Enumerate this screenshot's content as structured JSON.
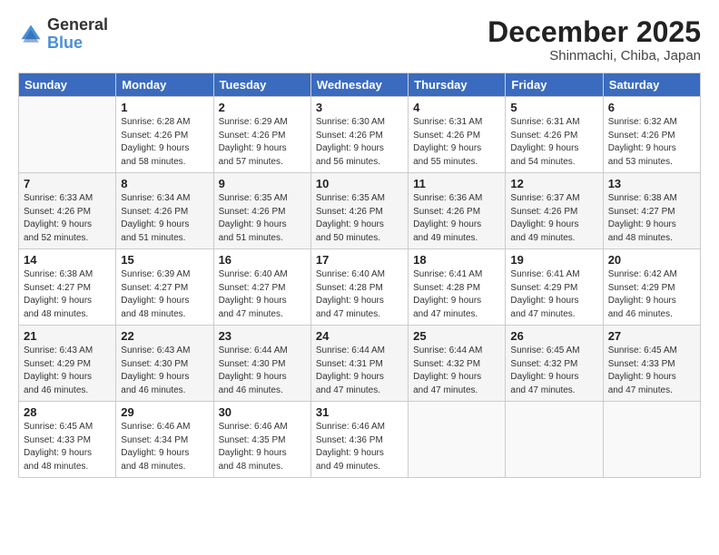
{
  "header": {
    "logo_general": "General",
    "logo_blue": "Blue",
    "month_title": "December 2025",
    "location": "Shinmachi, Chiba, Japan"
  },
  "days_of_week": [
    "Sunday",
    "Monday",
    "Tuesday",
    "Wednesday",
    "Thursday",
    "Friday",
    "Saturday"
  ],
  "weeks": [
    [
      {
        "day": "",
        "info": ""
      },
      {
        "day": "1",
        "info": "Sunrise: 6:28 AM\nSunset: 4:26 PM\nDaylight: 9 hours\nand 58 minutes."
      },
      {
        "day": "2",
        "info": "Sunrise: 6:29 AM\nSunset: 4:26 PM\nDaylight: 9 hours\nand 57 minutes."
      },
      {
        "day": "3",
        "info": "Sunrise: 6:30 AM\nSunset: 4:26 PM\nDaylight: 9 hours\nand 56 minutes."
      },
      {
        "day": "4",
        "info": "Sunrise: 6:31 AM\nSunset: 4:26 PM\nDaylight: 9 hours\nand 55 minutes."
      },
      {
        "day": "5",
        "info": "Sunrise: 6:31 AM\nSunset: 4:26 PM\nDaylight: 9 hours\nand 54 minutes."
      },
      {
        "day": "6",
        "info": "Sunrise: 6:32 AM\nSunset: 4:26 PM\nDaylight: 9 hours\nand 53 minutes."
      }
    ],
    [
      {
        "day": "7",
        "info": "Sunrise: 6:33 AM\nSunset: 4:26 PM\nDaylight: 9 hours\nand 52 minutes."
      },
      {
        "day": "8",
        "info": "Sunrise: 6:34 AM\nSunset: 4:26 PM\nDaylight: 9 hours\nand 51 minutes."
      },
      {
        "day": "9",
        "info": "Sunrise: 6:35 AM\nSunset: 4:26 PM\nDaylight: 9 hours\nand 51 minutes."
      },
      {
        "day": "10",
        "info": "Sunrise: 6:35 AM\nSunset: 4:26 PM\nDaylight: 9 hours\nand 50 minutes."
      },
      {
        "day": "11",
        "info": "Sunrise: 6:36 AM\nSunset: 4:26 PM\nDaylight: 9 hours\nand 49 minutes."
      },
      {
        "day": "12",
        "info": "Sunrise: 6:37 AM\nSunset: 4:26 PM\nDaylight: 9 hours\nand 49 minutes."
      },
      {
        "day": "13",
        "info": "Sunrise: 6:38 AM\nSunset: 4:27 PM\nDaylight: 9 hours\nand 48 minutes."
      }
    ],
    [
      {
        "day": "14",
        "info": "Sunrise: 6:38 AM\nSunset: 4:27 PM\nDaylight: 9 hours\nand 48 minutes."
      },
      {
        "day": "15",
        "info": "Sunrise: 6:39 AM\nSunset: 4:27 PM\nDaylight: 9 hours\nand 48 minutes."
      },
      {
        "day": "16",
        "info": "Sunrise: 6:40 AM\nSunset: 4:27 PM\nDaylight: 9 hours\nand 47 minutes."
      },
      {
        "day": "17",
        "info": "Sunrise: 6:40 AM\nSunset: 4:28 PM\nDaylight: 9 hours\nand 47 minutes."
      },
      {
        "day": "18",
        "info": "Sunrise: 6:41 AM\nSunset: 4:28 PM\nDaylight: 9 hours\nand 47 minutes."
      },
      {
        "day": "19",
        "info": "Sunrise: 6:41 AM\nSunset: 4:29 PM\nDaylight: 9 hours\nand 47 minutes."
      },
      {
        "day": "20",
        "info": "Sunrise: 6:42 AM\nSunset: 4:29 PM\nDaylight: 9 hours\nand 46 minutes."
      }
    ],
    [
      {
        "day": "21",
        "info": "Sunrise: 6:43 AM\nSunset: 4:29 PM\nDaylight: 9 hours\nand 46 minutes."
      },
      {
        "day": "22",
        "info": "Sunrise: 6:43 AM\nSunset: 4:30 PM\nDaylight: 9 hours\nand 46 minutes."
      },
      {
        "day": "23",
        "info": "Sunrise: 6:44 AM\nSunset: 4:30 PM\nDaylight: 9 hours\nand 46 minutes."
      },
      {
        "day": "24",
        "info": "Sunrise: 6:44 AM\nSunset: 4:31 PM\nDaylight: 9 hours\nand 47 minutes."
      },
      {
        "day": "25",
        "info": "Sunrise: 6:44 AM\nSunset: 4:32 PM\nDaylight: 9 hours\nand 47 minutes."
      },
      {
        "day": "26",
        "info": "Sunrise: 6:45 AM\nSunset: 4:32 PM\nDaylight: 9 hours\nand 47 minutes."
      },
      {
        "day": "27",
        "info": "Sunrise: 6:45 AM\nSunset: 4:33 PM\nDaylight: 9 hours\nand 47 minutes."
      }
    ],
    [
      {
        "day": "28",
        "info": "Sunrise: 6:45 AM\nSunset: 4:33 PM\nDaylight: 9 hours\nand 48 minutes."
      },
      {
        "day": "29",
        "info": "Sunrise: 6:46 AM\nSunset: 4:34 PM\nDaylight: 9 hours\nand 48 minutes."
      },
      {
        "day": "30",
        "info": "Sunrise: 6:46 AM\nSunset: 4:35 PM\nDaylight: 9 hours\nand 48 minutes."
      },
      {
        "day": "31",
        "info": "Sunrise: 6:46 AM\nSunset: 4:36 PM\nDaylight: 9 hours\nand 49 minutes."
      },
      {
        "day": "",
        "info": ""
      },
      {
        "day": "",
        "info": ""
      },
      {
        "day": "",
        "info": ""
      }
    ]
  ]
}
